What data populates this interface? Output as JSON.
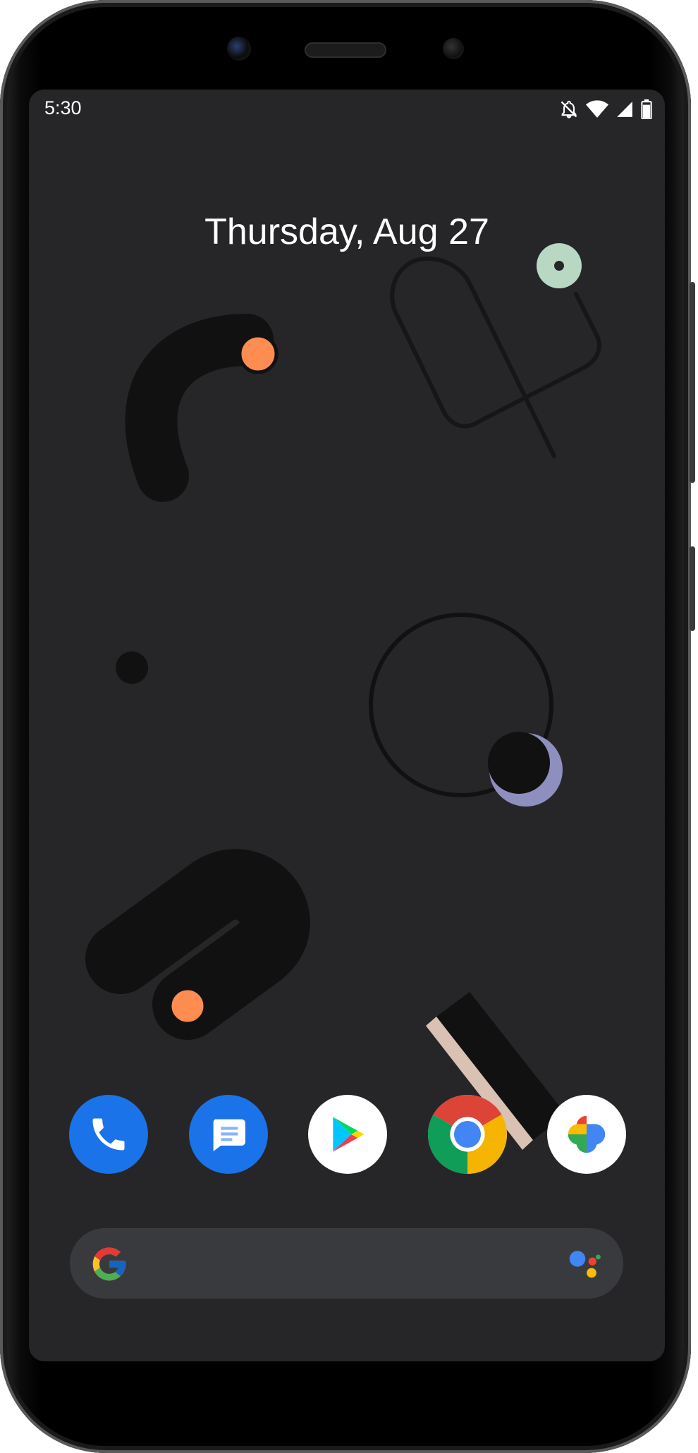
{
  "status_bar": {
    "time": "5:30",
    "icons": [
      "notifications-off-icon",
      "wifi-icon",
      "cellular-signal-icon",
      "battery-icon"
    ]
  },
  "home": {
    "date": "Thursday, Aug 27"
  },
  "dock": {
    "apps": [
      {
        "name": "Phone",
        "icon": "phone-icon",
        "color": "#1a73e8"
      },
      {
        "name": "Messages",
        "icon": "messages-icon",
        "color": "#1a73e8"
      },
      {
        "name": "Play Store",
        "icon": "play-store-icon",
        "color": "#ffffff"
      },
      {
        "name": "Chrome",
        "icon": "chrome-icon",
        "color": "#4285f4"
      },
      {
        "name": "Photos",
        "icon": "photos-icon",
        "color": "#ffffff"
      }
    ]
  },
  "search_bar": {
    "placeholder": "",
    "left_icon": "google-g-icon",
    "right_icon": "assistant-icon"
  },
  "colors": {
    "screen_bg": "#262628",
    "accent_orange": "#ff8c50",
    "accent_mint": "#b8d8c4",
    "accent_lavender": "#8f8fbf",
    "accent_blush": "#d9c1b4",
    "search_bg": "#393a3e"
  }
}
